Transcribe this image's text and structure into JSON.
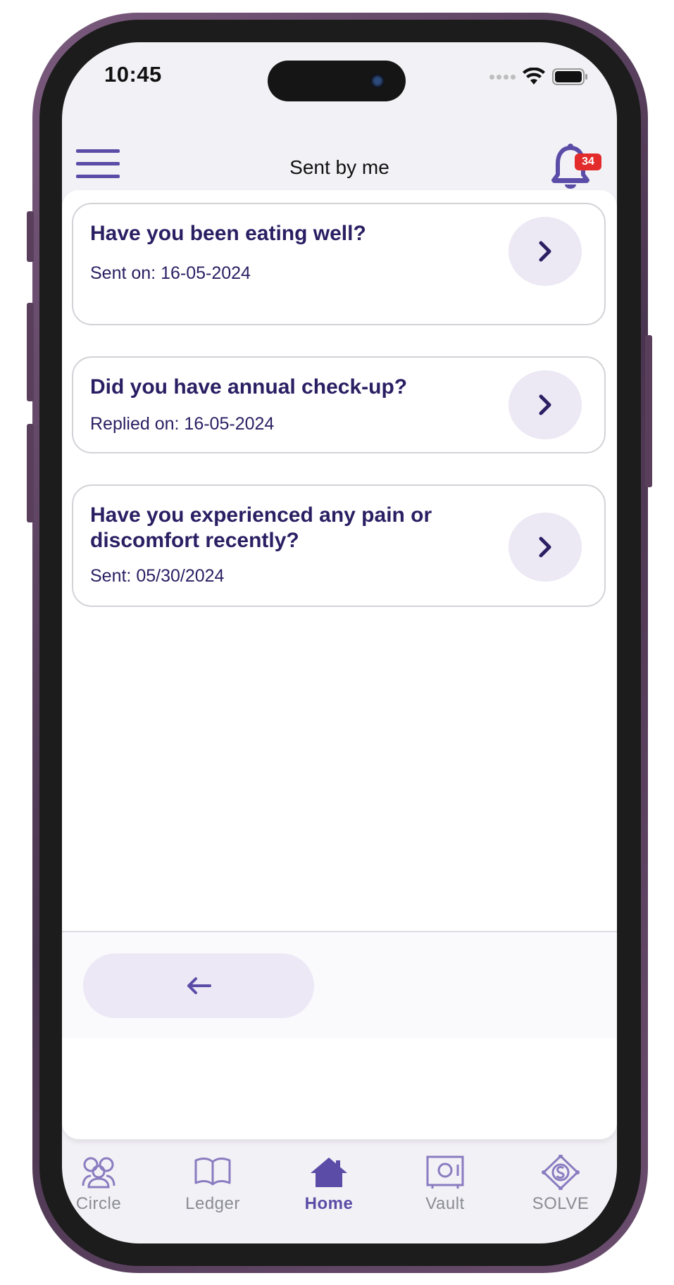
{
  "status_bar": {
    "time": "10:45"
  },
  "header": {
    "title": "Sent by me",
    "notification_count": "34"
  },
  "messages": [
    {
      "title": "Have you been eating well?",
      "subtitle": "Sent on: 16-05-2024"
    },
    {
      "title": "Did you have annual check-up?",
      "subtitle": "Replied on: 16-05-2024"
    },
    {
      "title": "Have you experienced any pain or discomfort recently?",
      "subtitle": "Sent: 05/30/2024"
    }
  ],
  "tabs": [
    {
      "label": "Circle",
      "icon": "circle-people-icon"
    },
    {
      "label": "Ledger",
      "icon": "book-icon"
    },
    {
      "label": "Home",
      "icon": "home-icon",
      "active": true
    },
    {
      "label": "Vault",
      "icon": "vault-icon"
    },
    {
      "label": "SOLVE",
      "icon": "solve-icon"
    }
  ],
  "colors": {
    "accent": "#5b4ca7",
    "title_text": "#2a1f63",
    "chevron_bg": "#ece8f4",
    "badge": "#e32b2b"
  }
}
